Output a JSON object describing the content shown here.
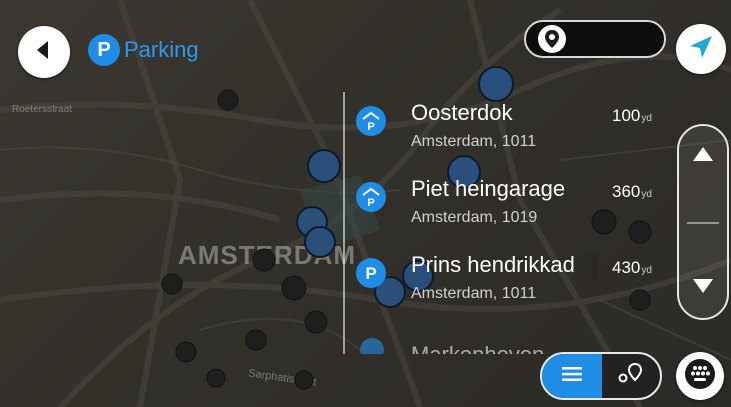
{
  "header": {
    "title": "Parking",
    "title_icon_letter": "P",
    "back_icon": "back-arrow-icon",
    "nav_icon": "navigation-arrow-icon"
  },
  "search": {
    "icon": "location-pin-icon",
    "value": ""
  },
  "map": {
    "city_label": "AMSTERDAM",
    "street_label_1": "Roetersstraat",
    "street_label_2": "Sarphatistraat"
  },
  "results": [
    {
      "name": "Oosterdok",
      "address": "Amsterdam, 1011",
      "distance": "100",
      "unit": "yd",
      "icon": "parking-garage-icon"
    },
    {
      "name": "Piet heingarage",
      "address": "Amsterdam, 1019",
      "distance": "360",
      "unit": "yd",
      "icon": "parking-garage-icon"
    },
    {
      "name": "Prins hendrikkad",
      "address": "Amsterdam, 1011",
      "distance": "430",
      "unit": "yd",
      "icon": "parking-icon"
    }
  ],
  "partial_result": "Markenhoven",
  "view_toggle": {
    "list_icon": "list-icon",
    "map_icon": "map-pins-icon",
    "selected": "list"
  },
  "keyboard_icon": "keyboard-icon",
  "colors": {
    "accent": "#1f8ce6",
    "nav_arrow": "#1fa7d9"
  }
}
